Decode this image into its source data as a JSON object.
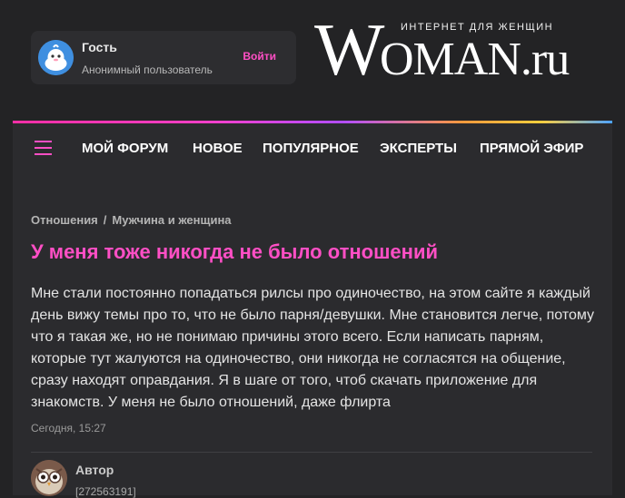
{
  "user_card": {
    "name": "Гость",
    "subtitle": "Анонимный пользователь",
    "login_label": "Войти"
  },
  "logo": {
    "tagline": "ИНТЕРНЕТ ДЛЯ ЖЕНЩИН",
    "big_letter": "W",
    "rest": "OMAN.ru"
  },
  "nav": {
    "items": [
      {
        "label": "МОЙ ФОРУМ"
      },
      {
        "label": "НОВОЕ"
      },
      {
        "label": "ПОПУЛЯРНОЕ"
      },
      {
        "label": "ЭКСПЕРТЫ"
      },
      {
        "label": "ПРЯМОЙ ЭФИР"
      }
    ]
  },
  "post": {
    "breadcrumb": [
      "Отношения",
      "Мужчина и женщина"
    ],
    "breadcrumb_sep": "/",
    "title": "У меня тоже никогда не было отношений",
    "body": "Мне стали постоянно попадаться рилсы про одиночество, на этом сайте я каждый день вижу темы про то, что не было парня/девушки. Мне становится легче, потому что я такая же, но не понимаю причины этого всего. Если написать парням, которые тут жалуются на одиночество, они никогда не согласятся на общение, сразу находят оправдания. Я в шаге от того, чтоб скачать приложение для знакомств. У меня не было отношений, даже флирта",
    "date": "Сегодня, 15:27"
  },
  "author": {
    "label": "Автор",
    "id": "[272563191]"
  },
  "colors": {
    "accent": "#ff4fc5",
    "background": "#232325",
    "panel": "#2b2b2e"
  },
  "icons": {
    "guest_avatar": "guest-whale-icon",
    "menu": "burger-menu-icon",
    "author_avatar": "owl-avatar-icon"
  }
}
